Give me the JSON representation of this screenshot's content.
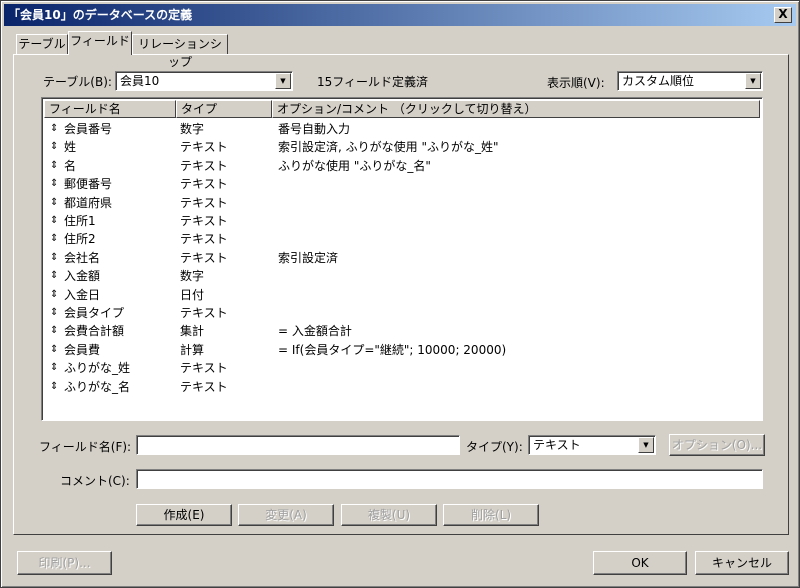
{
  "window": {
    "title": "「会員10」のデータベースの定義",
    "close_label": "X"
  },
  "tabs": [
    {
      "label": "テーブル"
    },
    {
      "label": "フィールド"
    },
    {
      "label": "リレーションシップ"
    }
  ],
  "table_select": {
    "label": "テーブル(B):",
    "value": "会員10",
    "defined_count": "15フィールド定義済"
  },
  "sort_select": {
    "label": "表示順(V):",
    "value": "カスタム順位"
  },
  "list": {
    "headers": [
      "フィールド名",
      "タイプ",
      "オプション/コメント （クリックして切り替え）"
    ],
    "rows": [
      {
        "name": "会員番号",
        "type": "数字",
        "option": "番号自動入力"
      },
      {
        "name": "姓",
        "type": "テキスト",
        "option": "索引設定済, ふりがな使用 \"ふりがな_姓\""
      },
      {
        "name": "名",
        "type": "テキスト",
        "option": "ふりがな使用 \"ふりがな_名\""
      },
      {
        "name": "郵便番号",
        "type": "テキスト",
        "option": ""
      },
      {
        "name": "都道府県",
        "type": "テキスト",
        "option": ""
      },
      {
        "name": "住所1",
        "type": "テキスト",
        "option": ""
      },
      {
        "name": "住所2",
        "type": "テキスト",
        "option": ""
      },
      {
        "name": "会社名",
        "type": "テキスト",
        "option": "索引設定済"
      },
      {
        "name": "入金額",
        "type": "数字",
        "option": ""
      },
      {
        "name": "入金日",
        "type": "日付",
        "option": ""
      },
      {
        "name": "会員タイプ",
        "type": "テキスト",
        "option": ""
      },
      {
        "name": "会費合計額",
        "type": "集計",
        "option": "= 入金額合計"
      },
      {
        "name": "会員費",
        "type": "計算",
        "option": "= If(会員タイプ=\"継続\"; 10000; 20000)"
      },
      {
        "name": "ふりがな_姓",
        "type": "テキスト",
        "option": ""
      },
      {
        "name": "ふりがな_名",
        "type": "テキスト",
        "option": ""
      }
    ]
  },
  "form": {
    "field_name_label": "フィールド名(F):",
    "field_name_value": "",
    "type_label": "タイプ(Y):",
    "type_value": "テキスト",
    "options_button": "オプション(O)...",
    "comment_label": "コメント(C):",
    "comment_value": ""
  },
  "actions": {
    "create": "作成(E)",
    "change": "変更(A)",
    "duplicate": "複製(U)",
    "delete": "削除(L)"
  },
  "footer": {
    "print": "印刷(P)...",
    "ok": "OK",
    "cancel": "キャンセル"
  }
}
